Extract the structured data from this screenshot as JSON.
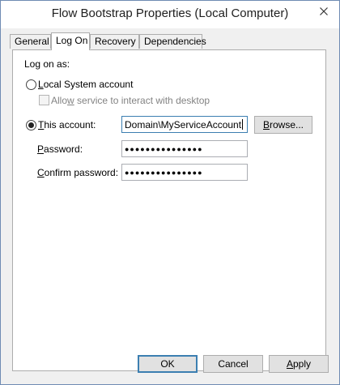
{
  "window": {
    "title": "Flow Bootstrap Properties (Local Computer)"
  },
  "tabs": [
    "General",
    "Log On",
    "Recovery",
    "Dependencies"
  ],
  "logon": {
    "log_on_as_label": "Log on as:",
    "local_system": {
      "mnemonic": "L",
      "rest": "ocal System account",
      "selected": false
    },
    "allow_interact": {
      "mnemonic": "w",
      "before": "Allo",
      "rest": " service to interact with desktop",
      "checked": false,
      "enabled": false
    },
    "this_account": {
      "mnemonic": "T",
      "rest": "his account:",
      "selected": true,
      "value": "Domain\\MyServiceAccount",
      "browse_mnemonic": "B",
      "browse_rest": "rowse..."
    },
    "password": {
      "mnemonic": "P",
      "rest": "assword:",
      "masked": "●●●●●●●●●●●●●●●"
    },
    "confirm_password": {
      "mnemonic": "C",
      "rest": "onfirm password:",
      "masked": "●●●●●●●●●●●●●●●"
    }
  },
  "buttons": {
    "ok": "OK",
    "cancel": "Cancel",
    "apply_mnemonic": "A",
    "apply_rest": "pply"
  },
  "icons": {
    "close": "close-icon"
  }
}
